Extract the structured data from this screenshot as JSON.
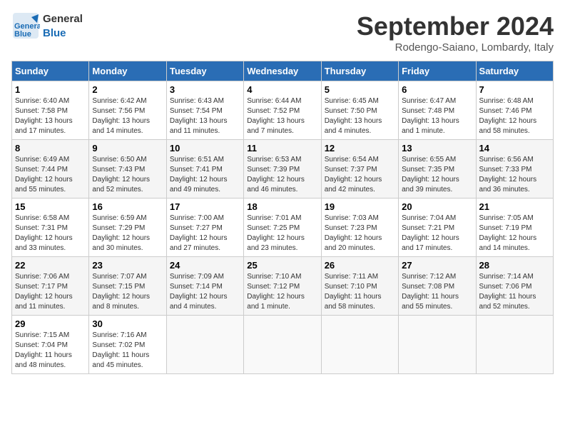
{
  "header": {
    "logo_line1": "General",
    "logo_line2": "Blue",
    "month": "September 2024",
    "location": "Rodengo-Saiano, Lombardy, Italy"
  },
  "weekdays": [
    "Sunday",
    "Monday",
    "Tuesday",
    "Wednesday",
    "Thursday",
    "Friday",
    "Saturday"
  ],
  "weeks": [
    [
      {
        "day": "1",
        "info": "Sunrise: 6:40 AM\nSunset: 7:58 PM\nDaylight: 13 hours\nand 17 minutes."
      },
      {
        "day": "2",
        "info": "Sunrise: 6:42 AM\nSunset: 7:56 PM\nDaylight: 13 hours\nand 14 minutes."
      },
      {
        "day": "3",
        "info": "Sunrise: 6:43 AM\nSunset: 7:54 PM\nDaylight: 13 hours\nand 11 minutes."
      },
      {
        "day": "4",
        "info": "Sunrise: 6:44 AM\nSunset: 7:52 PM\nDaylight: 13 hours\nand 7 minutes."
      },
      {
        "day": "5",
        "info": "Sunrise: 6:45 AM\nSunset: 7:50 PM\nDaylight: 13 hours\nand 4 minutes."
      },
      {
        "day": "6",
        "info": "Sunrise: 6:47 AM\nSunset: 7:48 PM\nDaylight: 13 hours\nand 1 minute."
      },
      {
        "day": "7",
        "info": "Sunrise: 6:48 AM\nSunset: 7:46 PM\nDaylight: 12 hours\nand 58 minutes."
      }
    ],
    [
      {
        "day": "8",
        "info": "Sunrise: 6:49 AM\nSunset: 7:44 PM\nDaylight: 12 hours\nand 55 minutes."
      },
      {
        "day": "9",
        "info": "Sunrise: 6:50 AM\nSunset: 7:43 PM\nDaylight: 12 hours\nand 52 minutes."
      },
      {
        "day": "10",
        "info": "Sunrise: 6:51 AM\nSunset: 7:41 PM\nDaylight: 12 hours\nand 49 minutes."
      },
      {
        "day": "11",
        "info": "Sunrise: 6:53 AM\nSunset: 7:39 PM\nDaylight: 12 hours\nand 46 minutes."
      },
      {
        "day": "12",
        "info": "Sunrise: 6:54 AM\nSunset: 7:37 PM\nDaylight: 12 hours\nand 42 minutes."
      },
      {
        "day": "13",
        "info": "Sunrise: 6:55 AM\nSunset: 7:35 PM\nDaylight: 12 hours\nand 39 minutes."
      },
      {
        "day": "14",
        "info": "Sunrise: 6:56 AM\nSunset: 7:33 PM\nDaylight: 12 hours\nand 36 minutes."
      }
    ],
    [
      {
        "day": "15",
        "info": "Sunrise: 6:58 AM\nSunset: 7:31 PM\nDaylight: 12 hours\nand 33 minutes."
      },
      {
        "day": "16",
        "info": "Sunrise: 6:59 AM\nSunset: 7:29 PM\nDaylight: 12 hours\nand 30 minutes."
      },
      {
        "day": "17",
        "info": "Sunrise: 7:00 AM\nSunset: 7:27 PM\nDaylight: 12 hours\nand 27 minutes."
      },
      {
        "day": "18",
        "info": "Sunrise: 7:01 AM\nSunset: 7:25 PM\nDaylight: 12 hours\nand 23 minutes."
      },
      {
        "day": "19",
        "info": "Sunrise: 7:03 AM\nSunset: 7:23 PM\nDaylight: 12 hours\nand 20 minutes."
      },
      {
        "day": "20",
        "info": "Sunrise: 7:04 AM\nSunset: 7:21 PM\nDaylight: 12 hours\nand 17 minutes."
      },
      {
        "day": "21",
        "info": "Sunrise: 7:05 AM\nSunset: 7:19 PM\nDaylight: 12 hours\nand 14 minutes."
      }
    ],
    [
      {
        "day": "22",
        "info": "Sunrise: 7:06 AM\nSunset: 7:17 PM\nDaylight: 12 hours\nand 11 minutes."
      },
      {
        "day": "23",
        "info": "Sunrise: 7:07 AM\nSunset: 7:15 PM\nDaylight: 12 hours\nand 8 minutes."
      },
      {
        "day": "24",
        "info": "Sunrise: 7:09 AM\nSunset: 7:14 PM\nDaylight: 12 hours\nand 4 minutes."
      },
      {
        "day": "25",
        "info": "Sunrise: 7:10 AM\nSunset: 7:12 PM\nDaylight: 12 hours\nand 1 minute."
      },
      {
        "day": "26",
        "info": "Sunrise: 7:11 AM\nSunset: 7:10 PM\nDaylight: 11 hours\nand 58 minutes."
      },
      {
        "day": "27",
        "info": "Sunrise: 7:12 AM\nSunset: 7:08 PM\nDaylight: 11 hours\nand 55 minutes."
      },
      {
        "day": "28",
        "info": "Sunrise: 7:14 AM\nSunset: 7:06 PM\nDaylight: 11 hours\nand 52 minutes."
      }
    ],
    [
      {
        "day": "29",
        "info": "Sunrise: 7:15 AM\nSunset: 7:04 PM\nDaylight: 11 hours\nand 48 minutes."
      },
      {
        "day": "30",
        "info": "Sunrise: 7:16 AM\nSunset: 7:02 PM\nDaylight: 11 hours\nand 45 minutes."
      },
      {
        "day": "",
        "info": ""
      },
      {
        "day": "",
        "info": ""
      },
      {
        "day": "",
        "info": ""
      },
      {
        "day": "",
        "info": ""
      },
      {
        "day": "",
        "info": ""
      }
    ]
  ]
}
